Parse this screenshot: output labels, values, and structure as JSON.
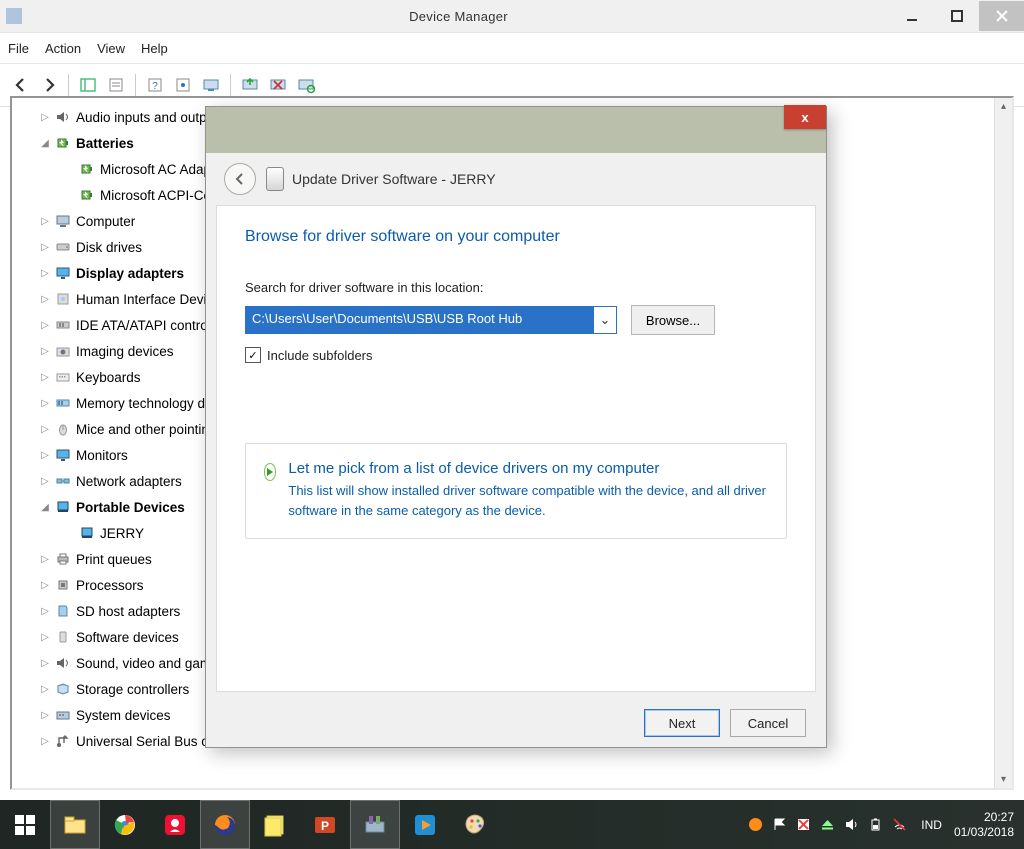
{
  "window": {
    "title": "Device Manager"
  },
  "menubar": [
    "File",
    "Action",
    "View",
    "Help"
  ],
  "tree": [
    {
      "indent": 1,
      "expander": "▷",
      "icon": "audio",
      "label": "Audio inputs and outputs",
      "bold": false
    },
    {
      "indent": 1,
      "expander": "◢",
      "icon": "battery",
      "label": "Batteries",
      "bold": true
    },
    {
      "indent": 2,
      "expander": "",
      "icon": "battery",
      "label": "Microsoft AC Adapter",
      "bold": false
    },
    {
      "indent": 2,
      "expander": "",
      "icon": "battery",
      "label": "Microsoft ACPI-Compliant Control Method Battery",
      "bold": false
    },
    {
      "indent": 1,
      "expander": "▷",
      "icon": "computer",
      "label": "Computer",
      "bold": false
    },
    {
      "indent": 1,
      "expander": "▷",
      "icon": "disk",
      "label": "Disk drives",
      "bold": false
    },
    {
      "indent": 1,
      "expander": "▷",
      "icon": "display",
      "label": "Display adapters",
      "bold": true
    },
    {
      "indent": 1,
      "expander": "▷",
      "icon": "hid",
      "label": "Human Interface Devices",
      "bold": false
    },
    {
      "indent": 1,
      "expander": "▷",
      "icon": "ide",
      "label": "IDE ATA/ATAPI controllers",
      "bold": false
    },
    {
      "indent": 1,
      "expander": "▷",
      "icon": "imaging",
      "label": "Imaging devices",
      "bold": false
    },
    {
      "indent": 1,
      "expander": "▷",
      "icon": "keyboard",
      "label": "Keyboards",
      "bold": false
    },
    {
      "indent": 1,
      "expander": "▷",
      "icon": "memory",
      "label": "Memory technology devices",
      "bold": false
    },
    {
      "indent": 1,
      "expander": "▷",
      "icon": "mouse",
      "label": "Mice and other pointing devices",
      "bold": false
    },
    {
      "indent": 1,
      "expander": "▷",
      "icon": "monitor",
      "label": "Monitors",
      "bold": false
    },
    {
      "indent": 1,
      "expander": "▷",
      "icon": "network",
      "label": "Network adapters",
      "bold": false
    },
    {
      "indent": 1,
      "expander": "◢",
      "icon": "portable",
      "label": "Portable Devices",
      "bold": true
    },
    {
      "indent": 2,
      "expander": "",
      "icon": "portable",
      "label": "JERRY",
      "bold": false
    },
    {
      "indent": 1,
      "expander": "▷",
      "icon": "printer",
      "label": "Print queues",
      "bold": false
    },
    {
      "indent": 1,
      "expander": "▷",
      "icon": "cpu",
      "label": "Processors",
      "bold": false
    },
    {
      "indent": 1,
      "expander": "▷",
      "icon": "sd",
      "label": "SD host adapters",
      "bold": false
    },
    {
      "indent": 1,
      "expander": "▷",
      "icon": "software",
      "label": "Software devices",
      "bold": false
    },
    {
      "indent": 1,
      "expander": "▷",
      "icon": "audio",
      "label": "Sound, video and game controllers",
      "bold": false
    },
    {
      "indent": 1,
      "expander": "▷",
      "icon": "storage",
      "label": "Storage controllers",
      "bold": false
    },
    {
      "indent": 1,
      "expander": "▷",
      "icon": "system",
      "label": "System devices",
      "bold": false
    },
    {
      "indent": 1,
      "expander": "▷",
      "icon": "usb",
      "label": "Universal Serial Bus controllers",
      "bold": false
    }
  ],
  "dialog": {
    "title": "Update Driver Software - JERRY",
    "heading": "Browse for driver software on your computer",
    "search_label": "Search for driver software in this location:",
    "path": "C:\\Users\\User\\Documents\\USB\\USB Root Hub",
    "browse": "Browse...",
    "include_subfolders": "Include subfolders",
    "include_subfolders_checked": true,
    "option_title": "Let me pick from a list of device drivers on my computer",
    "option_desc": "This list will show installed driver software compatible with the device, and all driver software in the same category as the device.",
    "next": "Next",
    "cancel": "Cancel",
    "close_glyph": "x"
  },
  "taskbar": {
    "lang": "IND",
    "time": "20:27",
    "date": "01/03/2018"
  }
}
